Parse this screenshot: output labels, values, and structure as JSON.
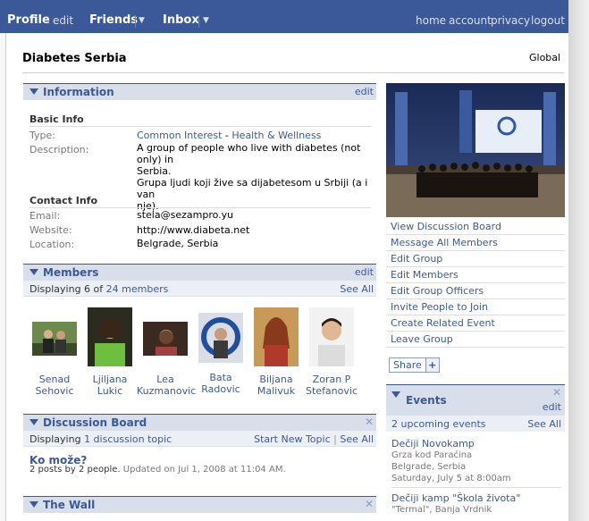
{
  "topbar": {
    "profile": "Profile",
    "edit": "edit",
    "friends": "Friends",
    "inbox": "Inbox",
    "home": "home",
    "account": "account",
    "privacy": "privacy",
    "logout": "logout",
    "color": "#3b5998"
  },
  "group": {
    "name": "Diabetes Serbia",
    "network": "Global"
  },
  "information": {
    "title": "Information",
    "edit": "edit",
    "basic_title": "Basic Info",
    "type_label": "Type:",
    "type_value_1": "Common Interest",
    "type_dash": " - ",
    "type_value_2": "Health & Wellness",
    "description_label": "Description:",
    "description_line1": "A group of people who live with diabetes (not only) in",
    "description_line2": "Serbia.",
    "description_line3": "Grupa ljudi koji žive sa dijabetesom u Srbiji (a i van",
    "description_line4": "nje).",
    "contact_title": "Contact Info",
    "email_label": "Email:",
    "email_value": "stela@sezampro.yu",
    "website_label": "Website:",
    "website_value": "http://www.diabeta.net",
    "location_label": "Location:",
    "location_value": "Belgrade, Serbia"
  },
  "members": {
    "title": "Members",
    "edit": "edit",
    "displaying": "Displaying 6 of",
    "count_link": "24 members",
    "see_all": "See All",
    "list": [
      {
        "first": "Senad",
        "last": "Sehovic"
      },
      {
        "first": "Ljiljana",
        "last": "Lukic"
      },
      {
        "first": "Lea",
        "last": "Kuzmanovic"
      },
      {
        "first": "Bata",
        "last": "Radovic"
      },
      {
        "first": "Biljana",
        "last": "Malivuk"
      },
      {
        "first": "Zoran P",
        "last": "Stefanovic"
      }
    ]
  },
  "discussion": {
    "title": "Discussion Board",
    "displaying": "Displaying",
    "topic_link": "1 discussion topic",
    "start_new": "Start New Topic",
    "pipe": "|",
    "see_all": "See All",
    "topic_title": "Ko može?",
    "topic_meta_posts": "2 posts by 2 people.",
    "topic_meta_updated": "Updated on Jul 1, 2008 at 11:04 AM."
  },
  "wall": {
    "title": "The Wall"
  },
  "actions": [
    "View Discussion Board",
    "Message All Members",
    "Edit Group",
    "Edit Members",
    "Edit Group Officers",
    "Invite People to Join",
    "Create Related Event",
    "Leave Group"
  ],
  "share": {
    "label": "Share",
    "plus": "+"
  },
  "events": {
    "title": "Events",
    "edit": "edit",
    "upcoming": "2 upcoming events",
    "see_all": "See All",
    "items": [
      {
        "name": "Dečiji Novokamp",
        "line1": "Grza kod Paraćina",
        "line2": "Belgrade, Serbia",
        "line3": "Saturday, July 5 at 8:00am"
      },
      {
        "name": "Dečiji kamp \"Škola života\"",
        "line1": "\"Termal\", Banja Vrdnik",
        "line2": "",
        "line3": ""
      }
    ]
  }
}
